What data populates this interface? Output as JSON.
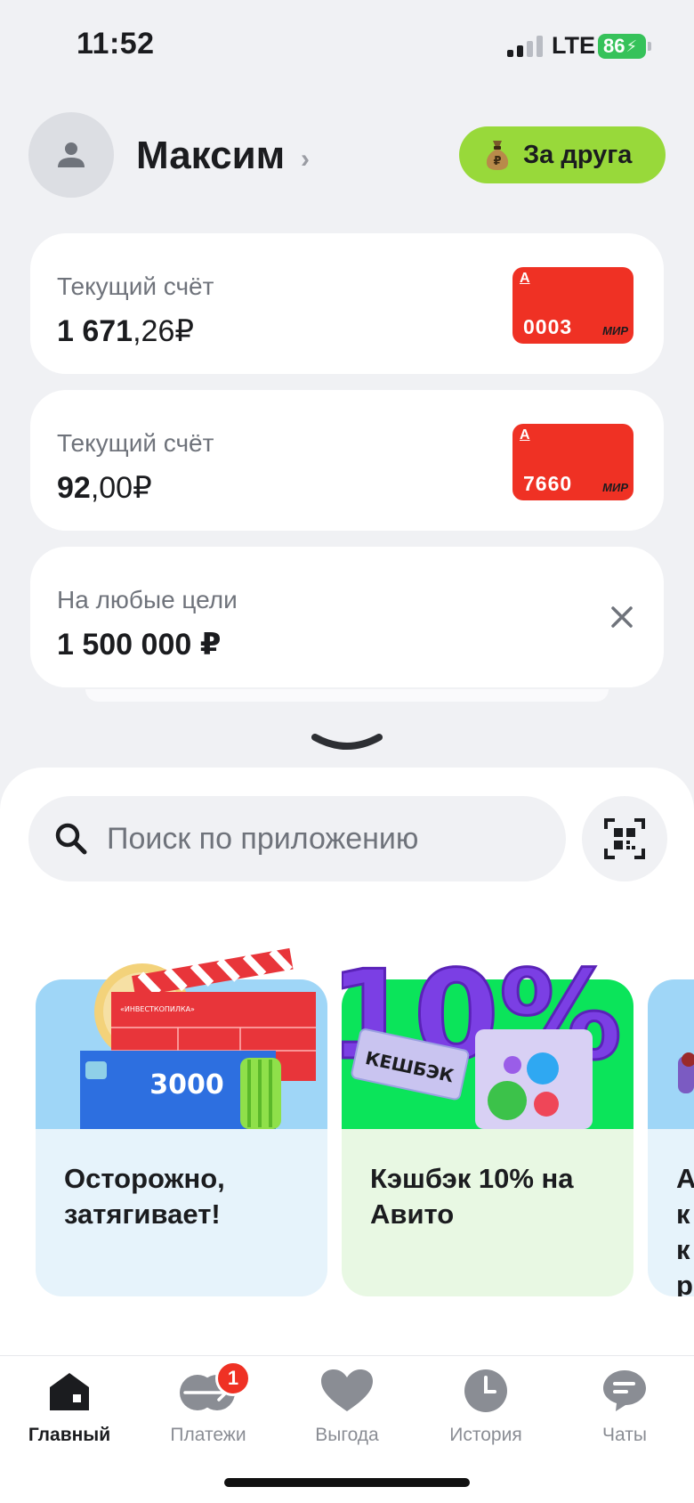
{
  "status_bar": {
    "time": "11:52",
    "network": "LTE",
    "battery": "86"
  },
  "header": {
    "user_name": "Максим",
    "friend_button": "За друга",
    "icons": [
      "avatar-icon",
      "money-bag-icon"
    ]
  },
  "accounts": [
    {
      "label": "Текущий счёт",
      "amount_main": "1 671",
      "amount_fraction": ",26",
      "currency": "₽",
      "card_last4": "0003",
      "card_brand": "МИР",
      "bank_mark": "А"
    },
    {
      "label": "Текущий счёт",
      "amount_main": "92",
      "amount_fraction": ",00",
      "currency": "₽",
      "card_last4": "7660",
      "card_brand": "МИР",
      "bank_mark": "А"
    },
    {
      "label": "На любые цели",
      "amount_main": "1 500 000 ₽"
    }
  ],
  "search": {
    "placeholder": "Поиск по приложению"
  },
  "promos": [
    {
      "title": "Осторожно, затягивает!",
      "art_text": "3000",
      "clapper_text": "«ИНВЕСТКОПИЛКА»"
    },
    {
      "title": "Кэшбэк 10% на Авито",
      "art_text": "10%",
      "sticker_text": "КЕШБЭК"
    },
    {
      "title": "А к кр"
    }
  ],
  "tabs": [
    {
      "label": "Главный",
      "icon": "home-icon",
      "active": true
    },
    {
      "label": "Платежи",
      "icon": "payments-icon",
      "badge": "1"
    },
    {
      "label": "Выгода",
      "icon": "heart-icon"
    },
    {
      "label": "История",
      "icon": "clock-icon"
    },
    {
      "label": "Чаты",
      "icon": "chat-icon"
    }
  ],
  "colors": {
    "accent_red": "#ef3124",
    "friend_green": "#98d93a",
    "background": "#f0f1f4",
    "battery_green": "#36c25a"
  }
}
